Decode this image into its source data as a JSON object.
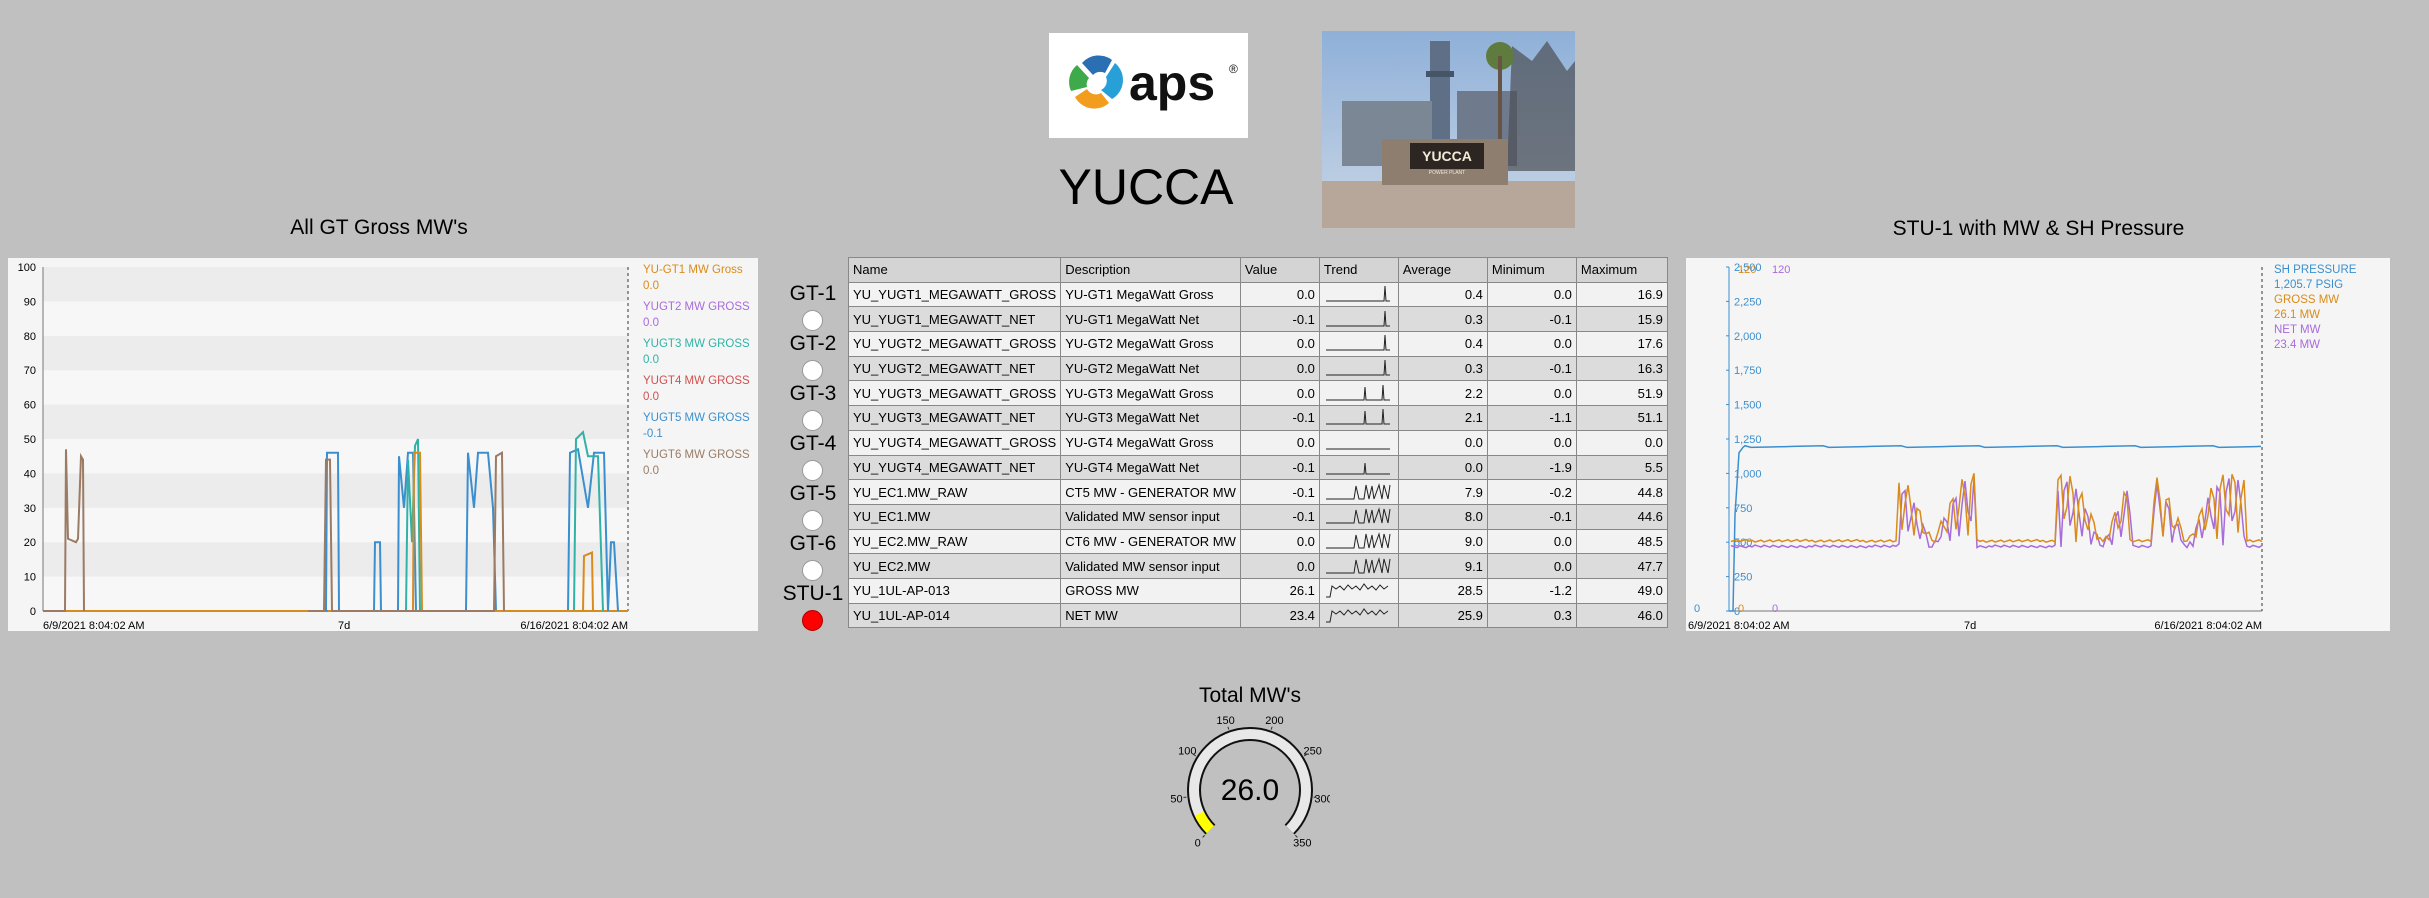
{
  "header": {
    "site_name": "YUCCA",
    "logo_text": "aps",
    "logo_mark": "®",
    "photo_sign": "YUCCA",
    "photo_sign_sub": "POWER PLANT"
  },
  "colors": {
    "background": "#c0c0c0",
    "gt1": "#d98b1c",
    "gt2": "#a86bdc",
    "gt3": "#2fb3a7",
    "gt4": "#d34f4f",
    "gt5": "#3b8fcf",
    "gt6": "#9b7b64",
    "sh_pressure": "#3b8fcf",
    "gross_mw": "#d98b1c",
    "net_mw": "#a86bdc",
    "status_off": "#ffffff",
    "status_on": "#ff0000",
    "gauge_fill": "#ffff00"
  },
  "left_chart": {
    "title": "All GT Gross MW's",
    "chart_data": {
      "type": "line",
      "title": "All GT Gross MW's",
      "ylim": [
        0,
        100
      ],
      "y_ticks": [
        "100",
        "90",
        "80",
        "70",
        "60",
        "50",
        "40",
        "30",
        "20",
        "10",
        "0"
      ],
      "x_start_label": "6/9/2021 8:04:02 AM",
      "x_mid_label": "7d",
      "x_end_label": "6/16/2021 8:04:02 AM",
      "grid": "horizontal bands",
      "legend_position": "right",
      "series": [
        {
          "name": "YU-GT1 MW Gross",
          "value": "0.0",
          "color": "#d98b1c"
        },
        {
          "name": "YUGT2 MW GROSS",
          "value": "0.0",
          "color": "#a86bdc"
        },
        {
          "name": "YUGT3 MW GROSS",
          "value": "0.0",
          "color": "#2fb3a7"
        },
        {
          "name": "YUGT4 MW GROSS",
          "value": "0.0",
          "color": "#d34f4f"
        },
        {
          "name": "YUGT5 MW GROSS",
          "value": "-0.1",
          "color": "#3b8fcf"
        },
        {
          "name": "YUGT6 MW GROSS",
          "value": "0.0",
          "color": "#9b7b64"
        }
      ]
    }
  },
  "right_chart": {
    "title": "STU-1 with MW & SH Pressure",
    "chart_data": {
      "type": "line",
      "title": "STU-1 with MW & SH Pressure",
      "ylim": [
        0,
        2500
      ],
      "y_ticks": [
        "2,500",
        "2,250",
        "2,000",
        "1,750",
        "1,500",
        "1,250",
        "1,000",
        "750",
        "500",
        "250",
        "0"
      ],
      "top_scale_labels": [
        "120",
        "120"
      ],
      "bottom_scale_labels": [
        "0",
        "0",
        "0"
      ],
      "x_start_label": "6/9/2021 8:04:02 AM",
      "x_mid_label": "7d",
      "x_end_label": "6/16/2021 8:04:02 AM",
      "legend_position": "right",
      "series": [
        {
          "name": "SH PRESSURE",
          "value": "1,205.7 PSIG",
          "color": "#3b8fcf"
        },
        {
          "name": "GROSS MW",
          "value": "26.1 MW",
          "color": "#d98b1c"
        },
        {
          "name": "NET MW",
          "value": "23.4 MW",
          "color": "#a86bdc"
        }
      ]
    }
  },
  "table": {
    "headers": [
      "Name",
      "Description",
      "Value",
      "Trend",
      "Average",
      "Minimum",
      "Maximum"
    ],
    "rows": [
      {
        "name": "YU_YUGT1_MEGAWATT_GROSS",
        "description": "YU-GT1 MegaWatt Gross",
        "value": "0.0",
        "average": "0.4",
        "minimum": "0.0",
        "maximum": "16.9"
      },
      {
        "name": "YU_YUGT1_MEGAWATT_NET",
        "description": "YU-GT1 MegaWatt Net",
        "value": "-0.1",
        "average": "0.3",
        "minimum": "-0.1",
        "maximum": "15.9"
      },
      {
        "name": "YU_YUGT2_MEGAWATT_GROSS",
        "description": "YU-GT2 MegaWatt Gross",
        "value": "0.0",
        "average": "0.4",
        "minimum": "0.0",
        "maximum": "17.6"
      },
      {
        "name": "YU_YUGT2_MEGAWATT_NET",
        "description": "YU-GT2 MegaWatt Net",
        "value": "0.0",
        "average": "0.3",
        "minimum": "-0.1",
        "maximum": "16.3"
      },
      {
        "name": "YU_YUGT3_MEGAWATT_GROSS",
        "description": "YU-GT3 MegaWatt Gross",
        "value": "0.0",
        "average": "2.2",
        "minimum": "0.0",
        "maximum": "51.9"
      },
      {
        "name": "YU_YUGT3_MEGAWATT_NET",
        "description": "YU-GT3 MegaWatt Net",
        "value": "-0.1",
        "average": "2.1",
        "minimum": "-1.1",
        "maximum": "51.1"
      },
      {
        "name": "YU_YUGT4_MEGAWATT_GROSS",
        "description": "YU-GT4 MegaWatt Gross",
        "value": "0.0",
        "average": "0.0",
        "minimum": "0.0",
        "maximum": "0.0"
      },
      {
        "name": "YU_YUGT4_MEGAWATT_NET",
        "description": "YU-GT4 MegaWatt Net",
        "value": "-0.1",
        "average": "0.0",
        "minimum": "-1.9",
        "maximum": "5.5"
      },
      {
        "name": "YU_EC1.MW_RAW",
        "description": "CT5 MW - GENERATOR MW",
        "value": "-0.1",
        "average": "7.9",
        "minimum": "-0.2",
        "maximum": "44.8"
      },
      {
        "name": "YU_EC1.MW",
        "description": "Validated MW sensor input",
        "value": "-0.1",
        "average": "8.0",
        "minimum": "-0.1",
        "maximum": "44.6"
      },
      {
        "name": "YU_EC2.MW_RAW",
        "description": "CT6 MW - GENERATOR MW",
        "value": "0.0",
        "average": "9.0",
        "minimum": "0.0",
        "maximum": "48.5"
      },
      {
        "name": "YU_EC2.MW",
        "description": "Validated MW sensor input",
        "value": "0.0",
        "average": "9.1",
        "minimum": "0.0",
        "maximum": "47.7"
      },
      {
        "name": "YU_1UL-AP-013",
        "description": "GROSS MW",
        "value": "26.1",
        "average": "28.5",
        "minimum": "-1.2",
        "maximum": "49.0"
      },
      {
        "name": "YU_1UL-AP-014",
        "description": "NET MW",
        "value": "23.4",
        "average": "25.9",
        "minimum": "0.3",
        "maximum": "46.0"
      }
    ]
  },
  "units": [
    {
      "label": "GT-1",
      "running": false
    },
    {
      "label": "GT-2",
      "running": false
    },
    {
      "label": "GT-3",
      "running": false
    },
    {
      "label": "GT-4",
      "running": false
    },
    {
      "label": "GT-5",
      "running": false
    },
    {
      "label": "GT-6",
      "running": false
    },
    {
      "label": "STU-1",
      "running": true
    }
  ],
  "total": {
    "title": "Total MW's",
    "value": "26.0",
    "value_number": 26.0,
    "range": [
      0,
      350
    ],
    "ticks": [
      "0",
      "50",
      "100",
      "150",
      "200",
      "250",
      "300",
      "350"
    ]
  }
}
